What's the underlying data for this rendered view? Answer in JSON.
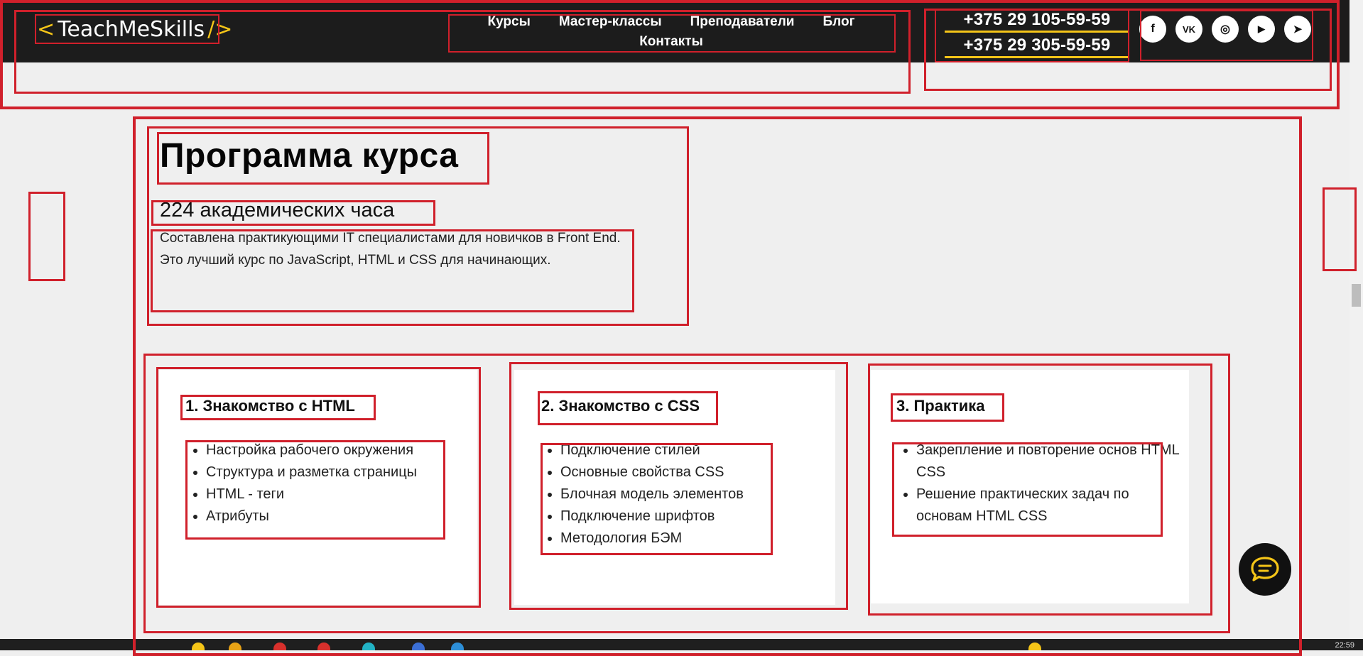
{
  "header": {
    "logo": {
      "left_bracket": "<",
      "text": "TeachMeSkills",
      "right_bracket": "/>"
    },
    "nav": [
      {
        "label": "Курсы"
      },
      {
        "label": "Мастер-классы"
      },
      {
        "label": "Преподаватели"
      },
      {
        "label": "Блог"
      },
      {
        "label": "Контакты"
      }
    ],
    "phones": [
      "+375 29 105-59-59",
      "+375 29 305-59-59"
    ],
    "socials": [
      {
        "icon": "facebook-icon",
        "glyph": "f"
      },
      {
        "icon": "vk-icon",
        "glyph": "VK"
      },
      {
        "icon": "instagram-icon",
        "glyph": "◎"
      },
      {
        "icon": "youtube-icon",
        "glyph": "▶"
      },
      {
        "icon": "telegram-icon",
        "glyph": "➤"
      }
    ]
  },
  "program": {
    "title": "Программа курса",
    "hours": "224 академических часа",
    "description": "Составлена практикующими IT специалистами для новичков в Front End. Это лучший курс по JavaScript, HTML и CSS для начинающих."
  },
  "modules": [
    {
      "title": "1. Знакомство с HTML",
      "items": [
        "Настройка рабочего окружения",
        "Структура и разметка страницы",
        "HTML - теги",
        "Атрибуты"
      ]
    },
    {
      "title": "2. Знакомство с CSS",
      "items": [
        "Подключение стилей",
        "Основные свойства CSS",
        "Блочная модель элементов",
        "Подключение шрифтов",
        "Методология БЭМ"
      ]
    },
    {
      "title": "3. Практика",
      "items": [
        "Закрепление и повторение основ HTML CSS",
        "Решение практических задач по основам HTML CSS"
      ]
    }
  ],
  "taskbar": {
    "clock": "22:59"
  },
  "colors": {
    "accent": "#f5c518",
    "header_bg": "#1c1c1c",
    "debug_outline": "#d0202b",
    "page_bg": "#efefef"
  }
}
